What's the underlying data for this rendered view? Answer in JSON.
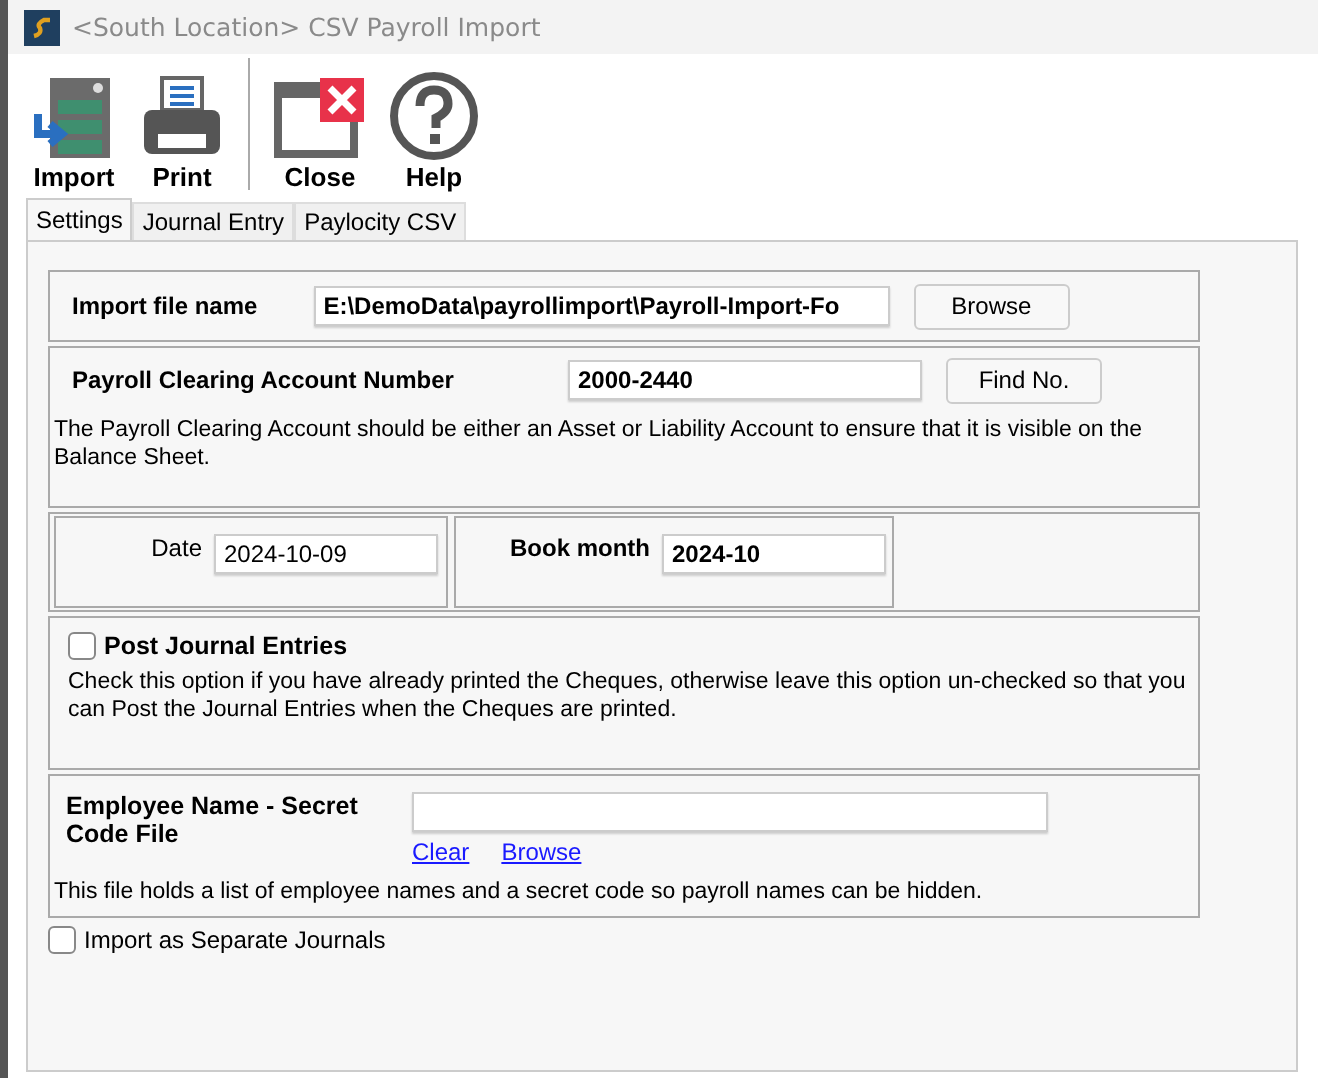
{
  "window": {
    "title": "<South Location> CSV Payroll Import"
  },
  "toolbar": [
    {
      "kind": "import",
      "label": "Import"
    },
    {
      "kind": "print",
      "label": "Print"
    },
    {
      "kind": "close",
      "label": "Close"
    },
    {
      "kind": "help",
      "label": "Help"
    }
  ],
  "tabs": [
    {
      "label": "Settings",
      "selected": true
    },
    {
      "label": "Journal Entry",
      "selected": false
    },
    {
      "label": "Paylocity CSV",
      "selected": false
    }
  ],
  "import_file": {
    "label": "Import file name",
    "value": "E:\\DemoData\\payrollimport\\Payroll-Import-Fo",
    "button": "Browse"
  },
  "clearing_account": {
    "label": "Payroll Clearing Account Number",
    "value": "2000-2440",
    "button": "Find No.",
    "note": "The Payroll Clearing Account should be either an Asset or Liability Account to ensure that it is visible on the Balance Sheet."
  },
  "date": {
    "label": "Date",
    "value": "2024-10-09"
  },
  "book_month": {
    "label": "Book month",
    "value": "2024-10"
  },
  "post_journal": {
    "label": "Post Journal Entries",
    "checked": false,
    "note": "Check this option if you have already printed the Cheques, otherwise leave this option un-checked so that you can Post the Journal Entries when the Cheques are printed."
  },
  "secret_code": {
    "label": "Employee Name - Secret Code File",
    "links": [
      "Clear",
      "Browse"
    ],
    "note": "This file holds a list of employee names and a secret code so payroll names can be hidden."
  },
  "separate_journals": {
    "label": "Import as Separate Journals",
    "checked": false
  }
}
